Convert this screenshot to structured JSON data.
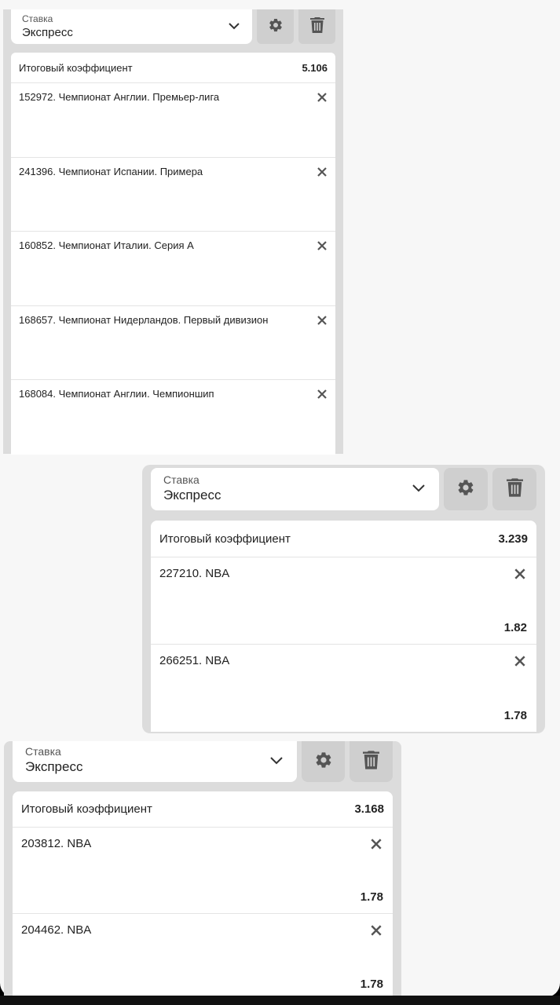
{
  "screens": [
    {
      "select": {
        "label": "Ставка",
        "value": "Экспресс"
      },
      "total": {
        "label": "Итоговый коэффициент",
        "value": "5.106"
      },
      "items": [
        {
          "title": "152972. Чемпионат Англии. Премьер-лига"
        },
        {
          "title": "241396. Чемпионат Испании. Примера"
        },
        {
          "title": "160852. Чемпионат Италии. Серия А"
        },
        {
          "title": "168657. Чемпионат Нидерландов. Первый дивизион"
        },
        {
          "title": "168084. Чемпионат Англии. Чемпионшип"
        }
      ]
    },
    {
      "select": {
        "label": "Ставка",
        "value": "Экспресс"
      },
      "total": {
        "label": "Итоговый коэффициент",
        "value": "3.239"
      },
      "items": [
        {
          "title": "227210. NBA",
          "odds": "1.82"
        },
        {
          "title": "266251. NBA",
          "odds": "1.78"
        }
      ]
    },
    {
      "select": {
        "label": "Ставка",
        "value": "Экспресс"
      },
      "total": {
        "label": "Итоговый коэффициент",
        "value": "3.168"
      },
      "items": [
        {
          "title": "203812. NBA",
          "odds": "1.78"
        },
        {
          "title": "204462. NBA",
          "odds": "1.78"
        }
      ]
    }
  ],
  "icons": {
    "select_chevron": "chevron-down-icon",
    "settings": "gear-icon",
    "delete": "trash-icon",
    "remove_item": "close-icon"
  },
  "colors": {
    "page_background": "#f7f7f7",
    "panel_background": "#dcdcdc",
    "card_background": "#ffffff",
    "icon_button_background": "#cfcfcf",
    "icon_color": "#555555"
  }
}
